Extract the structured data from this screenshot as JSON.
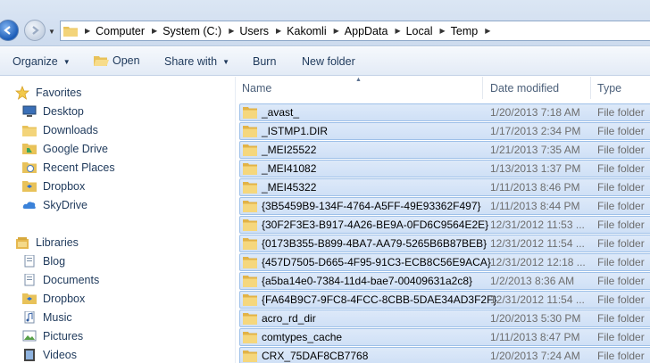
{
  "address": {
    "crumbs": [
      "Computer",
      "System (C:)",
      "Users",
      "Kakomli",
      "AppData",
      "Local",
      "Temp"
    ]
  },
  "toolbar": {
    "organize": "Organize",
    "open": "Open",
    "share_with": "Share with",
    "burn": "Burn",
    "new_folder": "New folder"
  },
  "nav": {
    "favorites": "Favorites",
    "favorite_items": [
      "Desktop",
      "Downloads",
      "Google Drive",
      "Recent Places",
      "Dropbox",
      "SkyDrive"
    ],
    "libraries": "Libraries",
    "library_items": [
      "Blog",
      "Documents",
      "Dropbox",
      "Music",
      "Pictures",
      "Videos"
    ]
  },
  "columns": {
    "name": "Name",
    "date": "Date modified",
    "type": "Type"
  },
  "files": [
    {
      "name": "_avast_",
      "date": "1/20/2013 7:18 AM",
      "type": "File folder"
    },
    {
      "name": "_ISTMP1.DIR",
      "date": "1/17/2013 2:34 PM",
      "type": "File folder"
    },
    {
      "name": "_MEI25522",
      "date": "1/21/2013 7:35 AM",
      "type": "File folder"
    },
    {
      "name": "_MEI41082",
      "date": "1/13/2013 1:37 PM",
      "type": "File folder"
    },
    {
      "name": "_MEI45322",
      "date": "1/11/2013 8:46 PM",
      "type": "File folder"
    },
    {
      "name": "{3B5459B9-134F-4764-A5FF-49E93362F497}",
      "date": "1/11/2013 8:44 PM",
      "type": "File folder"
    },
    {
      "name": "{30F2F3E3-B917-4A26-BE9A-0FD6C9564E2E}",
      "date": "12/31/2012 11:53 ...",
      "type": "File folder"
    },
    {
      "name": "{0173B355-B899-4BA7-AA79-5265B6B87BEB}",
      "date": "12/31/2012 11:54 ...",
      "type": "File folder"
    },
    {
      "name": "{457D7505-D665-4F95-91C3-ECB8C56E9ACA}",
      "date": "12/31/2012 12:18 ...",
      "type": "File folder"
    },
    {
      "name": "{a5ba14e0-7384-11d4-bae7-00409631a2c8}",
      "date": "1/2/2013 8:36 AM",
      "type": "File folder"
    },
    {
      "name": "{FA64B9C7-9FC8-4FCC-8CBB-5DAE34AD3F2F}",
      "date": "12/31/2012 11:54 ...",
      "type": "File folder"
    },
    {
      "name": "acro_rd_dir",
      "date": "1/20/2013 5:30 PM",
      "type": "File folder"
    },
    {
      "name": "comtypes_cache",
      "date": "1/11/2013 8:47 PM",
      "type": "File folder"
    },
    {
      "name": "CRX_75DAF8CB7768",
      "date": "1/20/2013 7:24 AM",
      "type": "File folder"
    }
  ],
  "icons": {
    "back": "back-arrow-icon",
    "forward": "forward-arrow-icon",
    "folder": "folder-icon",
    "favorites": "star-icon",
    "libraries": "libraries-icon"
  }
}
